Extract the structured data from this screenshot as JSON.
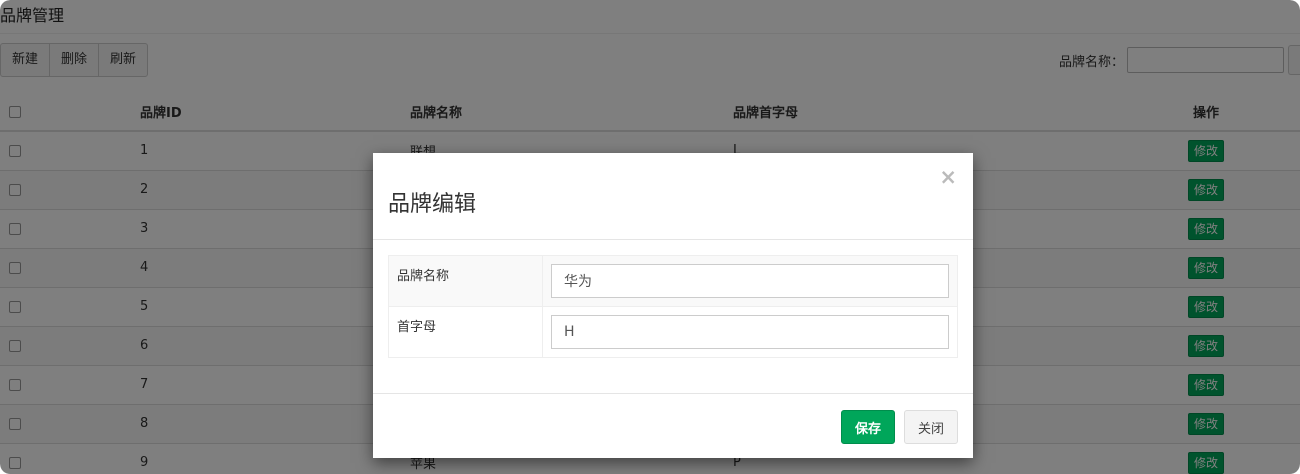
{
  "page": {
    "title": "品牌管理"
  },
  "toolbar": {
    "new_label": "新建",
    "delete_label": "删除",
    "refresh_label": "刷新"
  },
  "search": {
    "label": "品牌名称：",
    "value": ""
  },
  "table": {
    "headers": [
      "",
      "品牌ID",
      "品牌名称",
      "品牌首字母",
      "操作"
    ],
    "rows": [
      {
        "id": "1",
        "name": "联想",
        "letter": "L",
        "action": "修改"
      },
      {
        "id": "2",
        "name": "",
        "letter": "",
        "action": "修改"
      },
      {
        "id": "3",
        "name": "",
        "letter": "",
        "action": "修改"
      },
      {
        "id": "4",
        "name": "",
        "letter": "",
        "action": "修改"
      },
      {
        "id": "5",
        "name": "",
        "letter": "",
        "action": "修改"
      },
      {
        "id": "6",
        "name": "",
        "letter": "",
        "action": "修改"
      },
      {
        "id": "7",
        "name": "",
        "letter": "",
        "action": "修改"
      },
      {
        "id": "8",
        "name": "",
        "letter": "",
        "action": "修改"
      },
      {
        "id": "9",
        "name": "苹果",
        "letter": "P",
        "action": "修改"
      }
    ]
  },
  "modal": {
    "title": "品牌编辑",
    "close_glyph": "×",
    "fields": [
      {
        "label": "品牌名称",
        "value": "华为"
      },
      {
        "label": "首字母",
        "value": "H"
      }
    ],
    "save_label": "保存",
    "close_label": "关闭"
  },
  "colors": {
    "accent": "#00a65a",
    "overlay": "rgba(0,0,0,0.5)"
  }
}
